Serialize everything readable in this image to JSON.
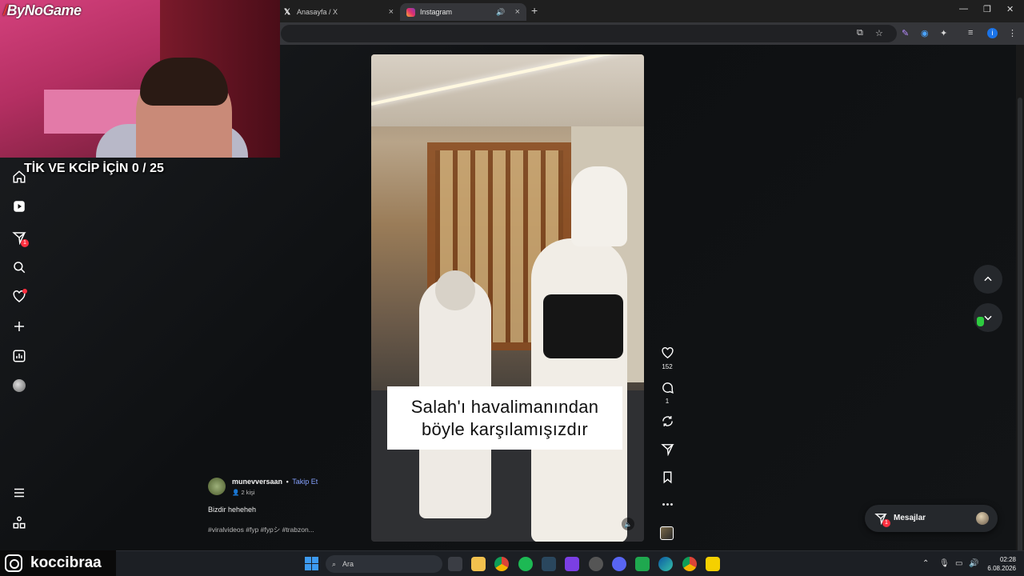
{
  "browser": {
    "tabs": [
      {
        "label": "Anasayfa / X",
        "icon": "x-logo-icon"
      },
      {
        "label": "Instagram",
        "icon": "instagram-icon",
        "active": true
      }
    ]
  },
  "stream": {
    "logo": "ByNoGame",
    "overlay_text": "TİK VE KCİP İÇİN 0 / 25",
    "channel_name": "koccibraa"
  },
  "sidebar": {
    "items": [
      {
        "name": "home-icon"
      },
      {
        "name": "reels-icon"
      },
      {
        "name": "messages-icon",
        "badge": "1"
      },
      {
        "name": "search-icon"
      },
      {
        "name": "notifications-icon"
      },
      {
        "name": "create-icon"
      },
      {
        "name": "dashboard-icon"
      },
      {
        "name": "profile-avatar"
      },
      {
        "name": "menu-icon"
      },
      {
        "name": "threads-icon"
      }
    ]
  },
  "reel": {
    "caption_lines": [
      "Salah'ı havalimanından",
      "böyle karşılamışızdır"
    ],
    "author": "munevversaan",
    "separator": "•",
    "follow_label": "Takip Et",
    "author_sub": "2 kişi",
    "post_caption": "Bizdir heheheh",
    "tags": "#viralvideos #fyp #fypシ #trabzon...",
    "likes": "152",
    "comments": "1"
  },
  "messages": {
    "label": "Mesajlar",
    "badge": "1"
  },
  "taskbar": {
    "search_placeholder": "Ara",
    "time": "02:28",
    "date": "6.08.2026"
  },
  "colors": {
    "accent_link": "#85a1ff",
    "notification_red": "#ff3040",
    "page_bg": "#0e1012"
  }
}
